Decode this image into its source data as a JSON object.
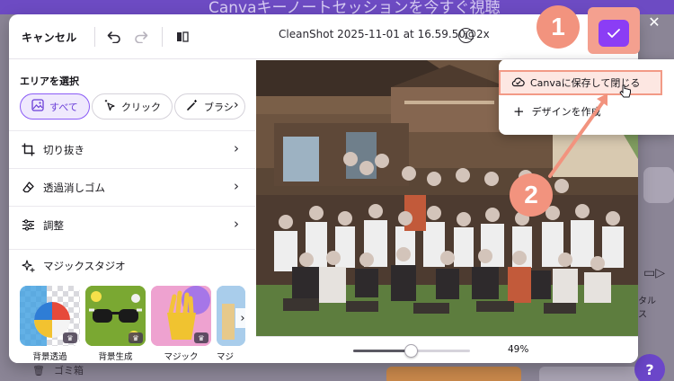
{
  "background": {
    "banner": "Canvaキーノートセッションを今すぐ視聴",
    "trash_label": "ゴミ箱",
    "right_text_1": "タル",
    "right_text_2": "ス",
    "help_label": "?"
  },
  "header": {
    "cancel_label": "キャンセル",
    "file_title": "CleanShot 2025-11-01 at 16.59.50@2x",
    "info_symbol": "i"
  },
  "panel": {
    "select_area_label": "エリアを選択",
    "chips": [
      {
        "label": "すべて",
        "active": true
      },
      {
        "label": "クリック",
        "active": false
      },
      {
        "label": "ブラシ",
        "active": false
      }
    ],
    "rows": [
      {
        "label": "切り抜き"
      },
      {
        "label": "透過消しゴム"
      },
      {
        "label": "調整"
      }
    ],
    "magic_label": "マジックスタジオ",
    "thumbs": [
      {
        "label": "背景透過"
      },
      {
        "label": "背景生成"
      },
      {
        "label": "マジック"
      },
      {
        "label": "マジ"
      }
    ]
  },
  "zoom": {
    "value_label": "49%",
    "level": 0.49
  },
  "dropdown": {
    "save_close_label": "Canvaに保存して閉じる",
    "create_design_label": "デザインを作成"
  },
  "annotations": {
    "badge_1": "1",
    "badge_2": "2"
  },
  "colors": {
    "accent": "#8b3df5",
    "chip_active": "#6b3fd8",
    "annotation": "#f2937e"
  }
}
